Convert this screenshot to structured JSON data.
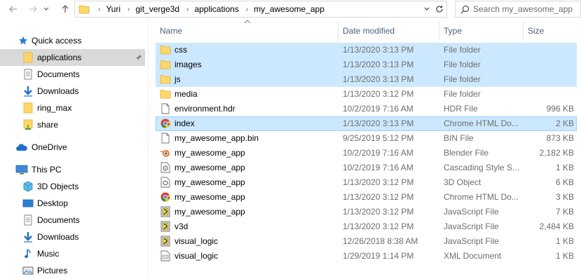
{
  "address": {
    "crumbs": [
      "Yuri",
      "git_verge3d",
      "applications",
      "my_awesome_app"
    ]
  },
  "search": {
    "placeholder": "Search my_awesome_app"
  },
  "navpane": {
    "quick_access": "Quick access",
    "items": [
      {
        "label": "applications",
        "icon": "folder-icon"
      },
      {
        "label": "Documents",
        "icon": "documents-icon"
      },
      {
        "label": "Downloads",
        "icon": "download-arrow-icon"
      },
      {
        "label": "ring_max",
        "icon": "folder-icon"
      },
      {
        "label": "share",
        "icon": "share-folder-icon"
      }
    ],
    "onedrive": "OneDrive",
    "this_pc": "This PC",
    "pc_items": [
      {
        "label": "3D Objects",
        "icon": "3d-objects-icon"
      },
      {
        "label": "Desktop",
        "icon": "desktop-icon"
      },
      {
        "label": "Documents",
        "icon": "documents-icon"
      },
      {
        "label": "Downloads",
        "icon": "download-arrow-icon"
      },
      {
        "label": "Music",
        "icon": "music-note-icon"
      },
      {
        "label": "Pictures",
        "icon": "pictures-icon"
      }
    ]
  },
  "columns": {
    "name": "Name",
    "date": "Date modified",
    "type": "Type",
    "size": "Size"
  },
  "files": [
    {
      "name": "css",
      "date": "1/13/2020 3:13 PM",
      "type": "File folder",
      "size": "",
      "icon": "folder-icon",
      "state": "selected"
    },
    {
      "name": "images",
      "date": "1/13/2020 3:13 PM",
      "type": "File folder",
      "size": "",
      "icon": "folder-icon",
      "state": "selected"
    },
    {
      "name": "js",
      "date": "1/13/2020 3:13 PM",
      "type": "File folder",
      "size": "",
      "icon": "folder-icon",
      "state": "selected"
    },
    {
      "name": "media",
      "date": "1/13/2020 3:12 PM",
      "type": "File folder",
      "size": "",
      "icon": "folder-icon",
      "state": ""
    },
    {
      "name": "environment.hdr",
      "date": "10/2/2019 7:16 AM",
      "type": "HDR File",
      "size": "996 KB",
      "icon": "blank-file-icon",
      "state": ""
    },
    {
      "name": "index",
      "date": "1/13/2020 3:13 PM",
      "type": "Chrome HTML Do...",
      "size": "2 KB",
      "icon": "chrome-icon",
      "state": "focus"
    },
    {
      "name": "my_awesome_app.bin",
      "date": "9/25/2019 5:12 PM",
      "type": "BIN File",
      "size": "873 KB",
      "icon": "blank-file-icon",
      "state": ""
    },
    {
      "name": "my_awesome_app",
      "date": "10/2/2019 7:16 AM",
      "type": "Blender File",
      "size": "2,182 KB",
      "icon": "blender-icon",
      "state": ""
    },
    {
      "name": "my_awesome_app",
      "date": "10/2/2019 7:16 AM",
      "type": "Cascading Style S...",
      "size": "1 KB",
      "icon": "css-gear-icon",
      "state": ""
    },
    {
      "name": "my_awesome_app",
      "date": "1/13/2020 3:12 PM",
      "type": "3D Object",
      "size": "6 KB",
      "icon": "3d-object-file-icon",
      "state": ""
    },
    {
      "name": "my_awesome_app",
      "date": "1/13/2020 3:12 PM",
      "type": "Chrome HTML Do...",
      "size": "3 KB",
      "icon": "chrome-icon",
      "state": ""
    },
    {
      "name": "my_awesome_app",
      "date": "1/13/2020 3:12 PM",
      "type": "JavaScript File",
      "size": "7 KB",
      "icon": "js-file-icon",
      "state": ""
    },
    {
      "name": "v3d",
      "date": "1/13/2020 3:12 PM",
      "type": "JavaScript File",
      "size": "2,484 KB",
      "icon": "js-file-icon",
      "state": ""
    },
    {
      "name": "visual_logic",
      "date": "12/26/2018 8:38 AM",
      "type": "JavaScript File",
      "size": "1 KB",
      "icon": "js-file-icon",
      "state": ""
    },
    {
      "name": "visual_logic",
      "date": "1/29/2019 1:14 PM",
      "type": "XML Document",
      "size": "1 KB",
      "icon": "xml-file-icon",
      "state": ""
    }
  ],
  "colors": {
    "selected_row": "#cce8ff",
    "focus_border": "#99d1ff",
    "nav_selected": "#d9d9d9",
    "header_text": "#4c607a",
    "folder": "#ffd766"
  }
}
